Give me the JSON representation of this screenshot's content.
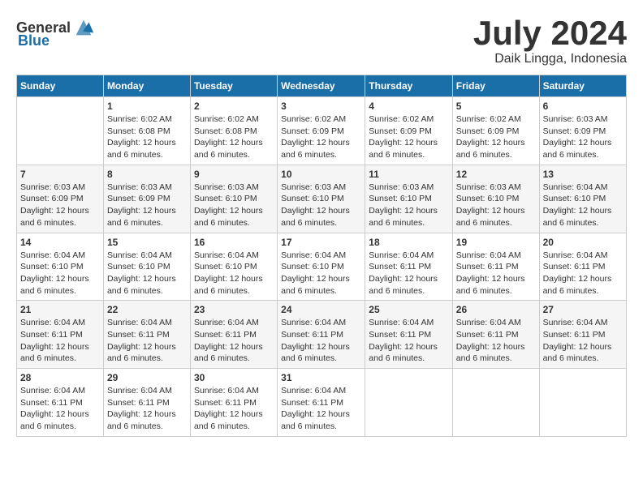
{
  "header": {
    "logo_general": "General",
    "logo_blue": "Blue",
    "month_title": "July 2024",
    "location": "Daik Lingga, Indonesia"
  },
  "days_of_week": [
    "Sunday",
    "Monday",
    "Tuesday",
    "Wednesday",
    "Thursday",
    "Friday",
    "Saturday"
  ],
  "weeks": [
    [
      {
        "day": "",
        "info": ""
      },
      {
        "day": "1",
        "info": "Sunrise: 6:02 AM\nSunset: 6:08 PM\nDaylight: 12 hours\nand 6 minutes."
      },
      {
        "day": "2",
        "info": "Sunrise: 6:02 AM\nSunset: 6:08 PM\nDaylight: 12 hours\nand 6 minutes."
      },
      {
        "day": "3",
        "info": "Sunrise: 6:02 AM\nSunset: 6:09 PM\nDaylight: 12 hours\nand 6 minutes."
      },
      {
        "day": "4",
        "info": "Sunrise: 6:02 AM\nSunset: 6:09 PM\nDaylight: 12 hours\nand 6 minutes."
      },
      {
        "day": "5",
        "info": "Sunrise: 6:02 AM\nSunset: 6:09 PM\nDaylight: 12 hours\nand 6 minutes."
      },
      {
        "day": "6",
        "info": "Sunrise: 6:03 AM\nSunset: 6:09 PM\nDaylight: 12 hours\nand 6 minutes."
      }
    ],
    [
      {
        "day": "7",
        "info": "Sunrise: 6:03 AM\nSunset: 6:09 PM\nDaylight: 12 hours\nand 6 minutes."
      },
      {
        "day": "8",
        "info": "Sunrise: 6:03 AM\nSunset: 6:09 PM\nDaylight: 12 hours\nand 6 minutes."
      },
      {
        "day": "9",
        "info": "Sunrise: 6:03 AM\nSunset: 6:10 PM\nDaylight: 12 hours\nand 6 minutes."
      },
      {
        "day": "10",
        "info": "Sunrise: 6:03 AM\nSunset: 6:10 PM\nDaylight: 12 hours\nand 6 minutes."
      },
      {
        "day": "11",
        "info": "Sunrise: 6:03 AM\nSunset: 6:10 PM\nDaylight: 12 hours\nand 6 minutes."
      },
      {
        "day": "12",
        "info": "Sunrise: 6:03 AM\nSunset: 6:10 PM\nDaylight: 12 hours\nand 6 minutes."
      },
      {
        "day": "13",
        "info": "Sunrise: 6:04 AM\nSunset: 6:10 PM\nDaylight: 12 hours\nand 6 minutes."
      }
    ],
    [
      {
        "day": "14",
        "info": "Sunrise: 6:04 AM\nSunset: 6:10 PM\nDaylight: 12 hours\nand 6 minutes."
      },
      {
        "day": "15",
        "info": "Sunrise: 6:04 AM\nSunset: 6:10 PM\nDaylight: 12 hours\nand 6 minutes."
      },
      {
        "day": "16",
        "info": "Sunrise: 6:04 AM\nSunset: 6:10 PM\nDaylight: 12 hours\nand 6 minutes."
      },
      {
        "day": "17",
        "info": "Sunrise: 6:04 AM\nSunset: 6:10 PM\nDaylight: 12 hours\nand 6 minutes."
      },
      {
        "day": "18",
        "info": "Sunrise: 6:04 AM\nSunset: 6:11 PM\nDaylight: 12 hours\nand 6 minutes."
      },
      {
        "day": "19",
        "info": "Sunrise: 6:04 AM\nSunset: 6:11 PM\nDaylight: 12 hours\nand 6 minutes."
      },
      {
        "day": "20",
        "info": "Sunrise: 6:04 AM\nSunset: 6:11 PM\nDaylight: 12 hours\nand 6 minutes."
      }
    ],
    [
      {
        "day": "21",
        "info": "Sunrise: 6:04 AM\nSunset: 6:11 PM\nDaylight: 12 hours\nand 6 minutes."
      },
      {
        "day": "22",
        "info": "Sunrise: 6:04 AM\nSunset: 6:11 PM\nDaylight: 12 hours\nand 6 minutes."
      },
      {
        "day": "23",
        "info": "Sunrise: 6:04 AM\nSunset: 6:11 PM\nDaylight: 12 hours\nand 6 minutes."
      },
      {
        "day": "24",
        "info": "Sunrise: 6:04 AM\nSunset: 6:11 PM\nDaylight: 12 hours\nand 6 minutes."
      },
      {
        "day": "25",
        "info": "Sunrise: 6:04 AM\nSunset: 6:11 PM\nDaylight: 12 hours\nand 6 minutes."
      },
      {
        "day": "26",
        "info": "Sunrise: 6:04 AM\nSunset: 6:11 PM\nDaylight: 12 hours\nand 6 minutes."
      },
      {
        "day": "27",
        "info": "Sunrise: 6:04 AM\nSunset: 6:11 PM\nDaylight: 12 hours\nand 6 minutes."
      }
    ],
    [
      {
        "day": "28",
        "info": "Sunrise: 6:04 AM\nSunset: 6:11 PM\nDaylight: 12 hours\nand 6 minutes."
      },
      {
        "day": "29",
        "info": "Sunrise: 6:04 AM\nSunset: 6:11 PM\nDaylight: 12 hours\nand 6 minutes."
      },
      {
        "day": "30",
        "info": "Sunrise: 6:04 AM\nSunset: 6:11 PM\nDaylight: 12 hours\nand 6 minutes."
      },
      {
        "day": "31",
        "info": "Sunrise: 6:04 AM\nSunset: 6:11 PM\nDaylight: 12 hours\nand 6 minutes."
      },
      {
        "day": "",
        "info": ""
      },
      {
        "day": "",
        "info": ""
      },
      {
        "day": "",
        "info": ""
      }
    ]
  ]
}
